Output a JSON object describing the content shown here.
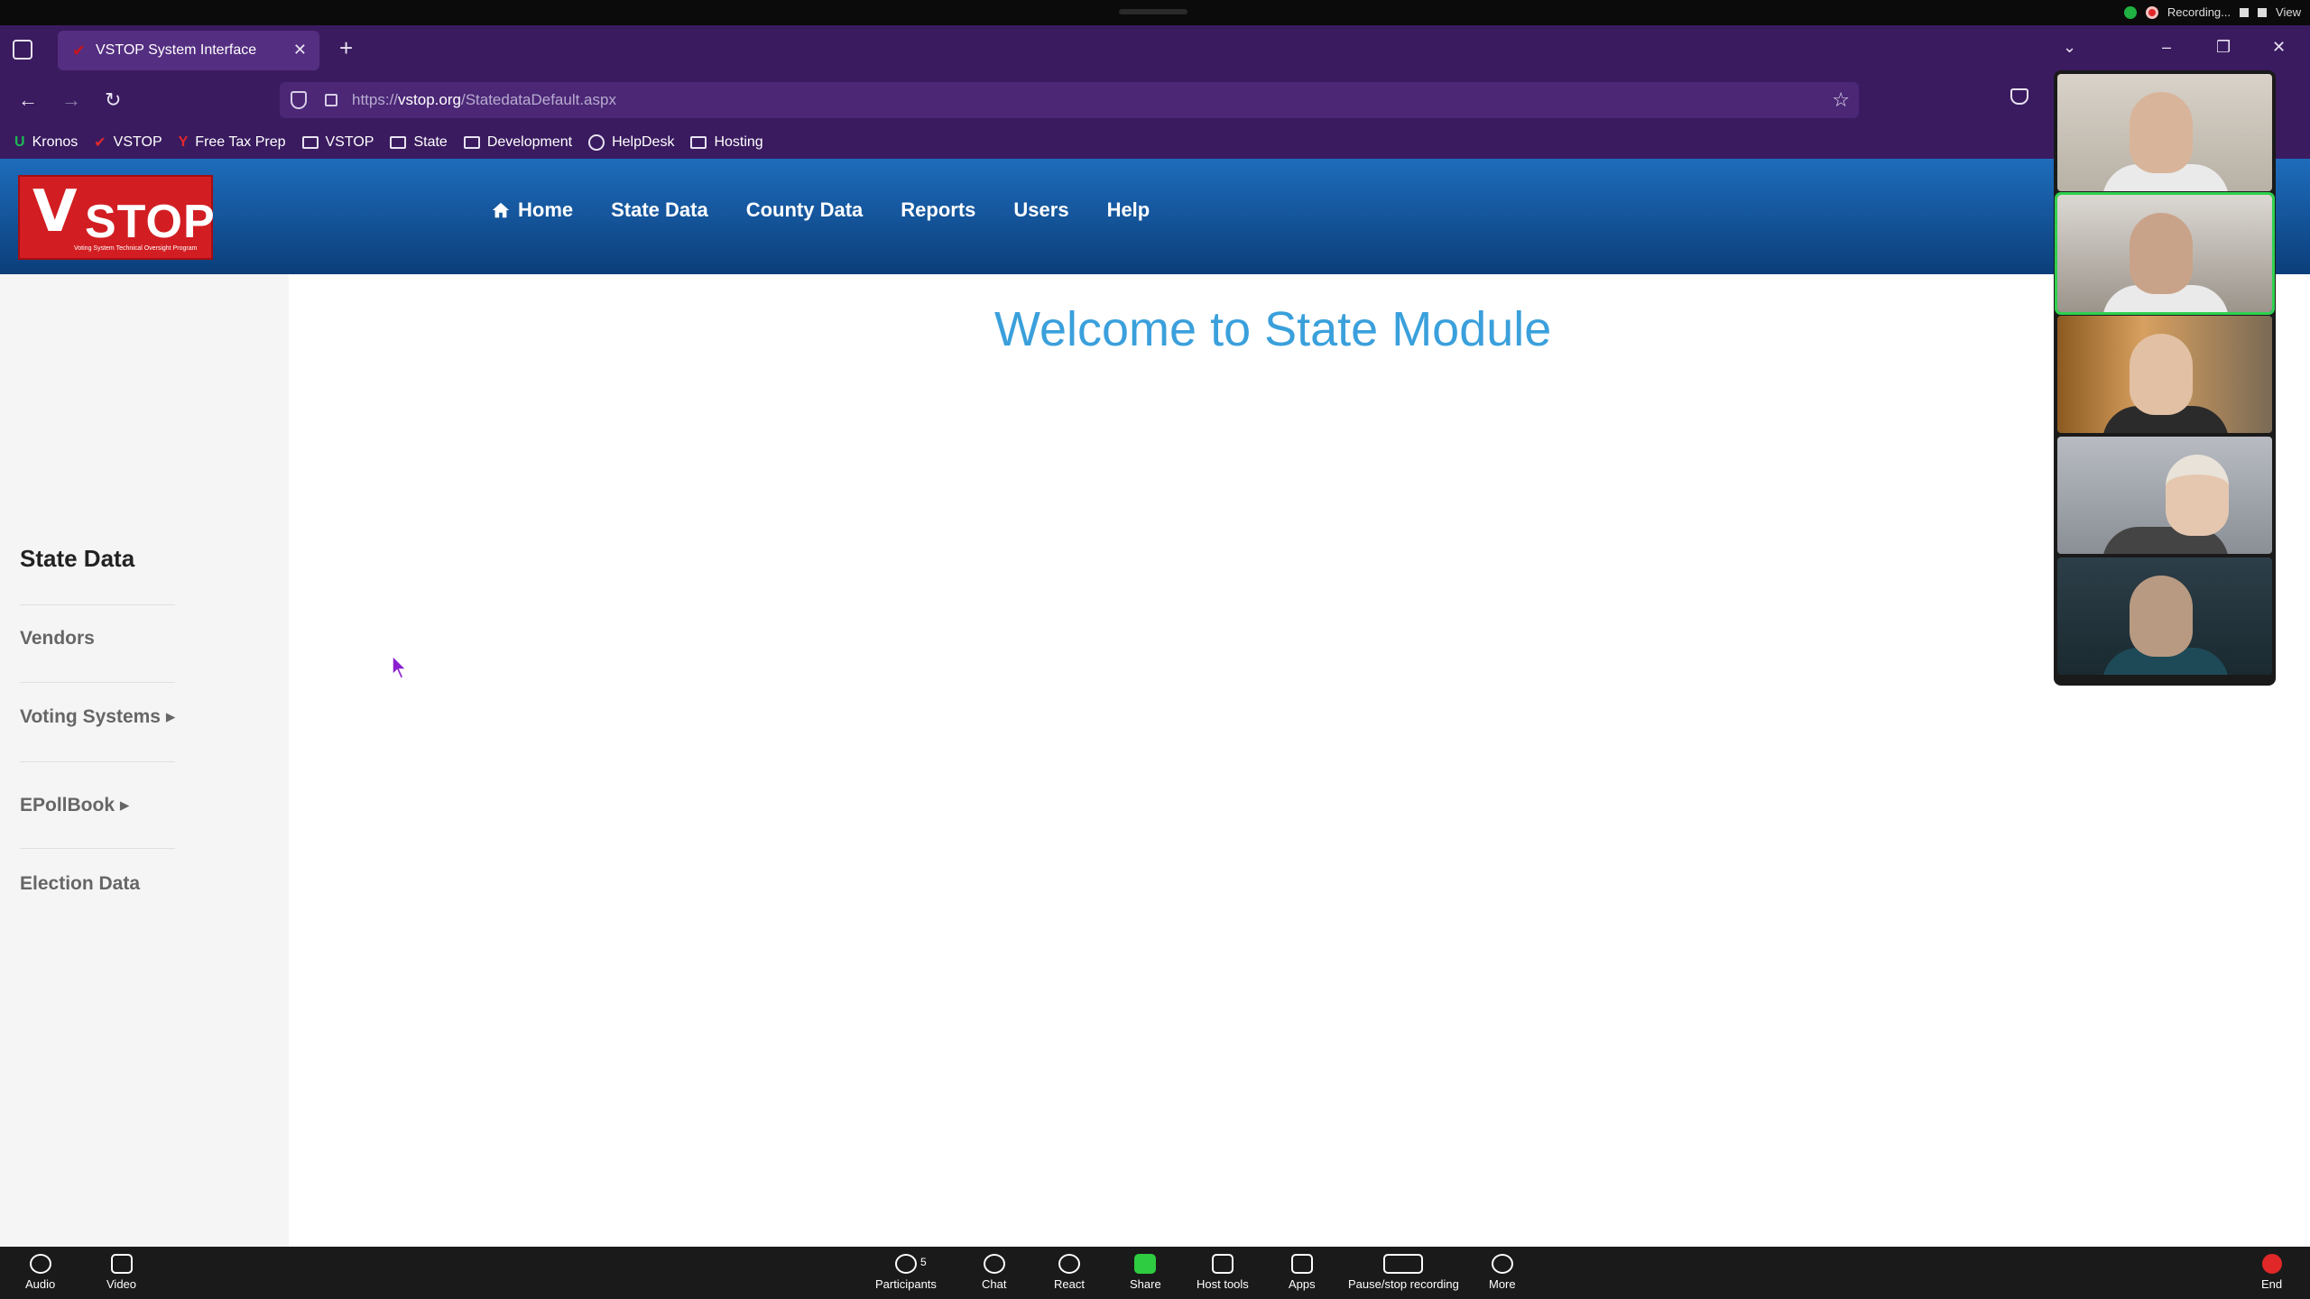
{
  "zoom": {
    "recording_label": "Recording...",
    "view_label": "View",
    "bottom": {
      "audio": "Audio",
      "video": "Video",
      "participants": "Participants",
      "participants_count": "5",
      "chat": "Chat",
      "react": "React",
      "share": "Share",
      "host_tools": "Host tools",
      "apps": "Apps",
      "pause_stop_recording": "Pause/stop recording",
      "more": "More",
      "end": "End"
    }
  },
  "browser": {
    "tab_title": "VSTOP System Interface",
    "url_prefix": "https://",
    "url_domain": "vstop.org",
    "url_path": "/StatedataDefault.aspx",
    "bookmarks": [
      "Kronos",
      "VSTOP",
      "Free Tax Prep",
      "VSTOP",
      "State",
      "Development",
      "HelpDesk",
      "Hosting"
    ]
  },
  "site": {
    "logo_text": "STOP",
    "logo_v": "V",
    "logo_subtitle": "Voting System Technical Oversight Program",
    "menu": [
      "Home",
      "State Data",
      "County Data",
      "Reports",
      "Users",
      "Help"
    ],
    "welcome": "Welcome to State Module",
    "sidebar": {
      "title": "State Data",
      "items": [
        "Vendors",
        "Voting Systems ▸",
        "EPollBook ▸",
        "Election Data"
      ]
    }
  }
}
